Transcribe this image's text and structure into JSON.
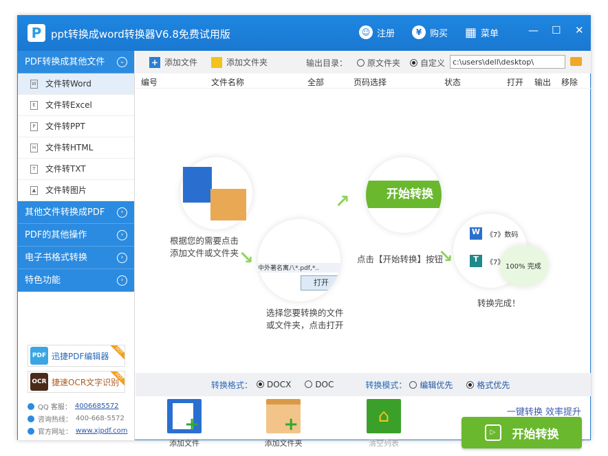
{
  "window": {
    "title": "ppt转换成word转换器V6.8免费试用版",
    "register": "注册",
    "buy": "购买",
    "menu": "菜单",
    "minimize": "—",
    "maximize": "☐",
    "close": "✕"
  },
  "sidebar": {
    "sections": [
      {
        "label": "PDF转换成其他文件"
      },
      {
        "label": "其他文件转换成PDF"
      },
      {
        "label": "PDF的其他操作"
      },
      {
        "label": "电子书格式转换"
      },
      {
        "label": "特色功能"
      }
    ],
    "items": [
      {
        "label": "文件转Word",
        "icon": "W"
      },
      {
        "label": "文件转Excel",
        "icon": "E"
      },
      {
        "label": "文件转PPT",
        "icon": "P"
      },
      {
        "label": "文件转HTML",
        "icon": "H"
      },
      {
        "label": "文件转TXT",
        "icon": "T"
      },
      {
        "label": "文件转图片",
        "icon": "▲"
      }
    ],
    "promos": [
      {
        "label": "迅捷PDF编辑器",
        "badge": "HOT",
        "icon": "PDF"
      },
      {
        "label": "捷速OCR文字识别",
        "badge": "HOT",
        "icon": "OCR"
      }
    ],
    "contacts": [
      {
        "label": "QQ 客服：",
        "value": "4006685572"
      },
      {
        "label": "咨询热线：",
        "value": "400-668-5572"
      },
      {
        "label": "官方网址：",
        "value": "www.xjpdf.com"
      }
    ]
  },
  "toolbar": {
    "add_file": "添加文件",
    "add_folder": "添加文件夹",
    "output_label": "输出目录：",
    "opt_original": "原文件夹",
    "opt_custom": "自定义",
    "path": "c:\\users\\dell\\desktop\\"
  },
  "table": {
    "columns": [
      "编号",
      "文件名称",
      "全部",
      "页码选择",
      "状态",
      "打开",
      "输出",
      "移除"
    ]
  },
  "guide": {
    "step1": "根据您的需要点击\n添加文件或文件夹",
    "step2": "选择您要转换的文件\n或文件夹，点击打开",
    "step3": "点击【开始转换】按钮",
    "step4": "转换完成！",
    "start_label": "开始转换",
    "dialog_file": "中外著名寓八*.pdf,*..",
    "dialog_open": "打开",
    "done_item1": "《7》数码",
    "done_item2": "《7》",
    "done_progress": "100%  完成"
  },
  "options": {
    "format_label": "转换格式：",
    "docx": "DOCX",
    "doc": "DOC",
    "mode_label": "转换模式：",
    "edit_first": "编辑优先",
    "format_first": "格式优先"
  },
  "bottom": {
    "add_file": "添加文件",
    "add_folder": "添加文件夹",
    "clear": "清空列表",
    "slogan": "一键转换  效率提升",
    "start": "开始转换"
  }
}
